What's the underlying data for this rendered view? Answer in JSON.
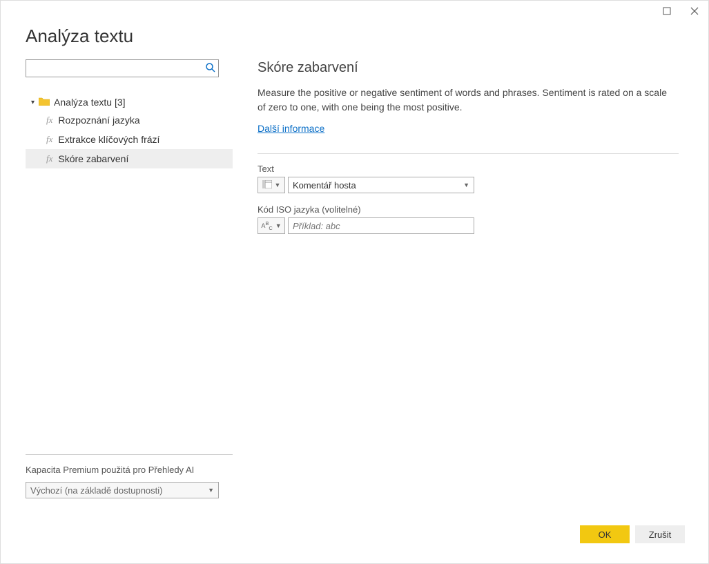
{
  "window": {
    "title": "Analýza textu"
  },
  "search": {
    "value": "",
    "placeholder": ""
  },
  "tree": {
    "root_label": "Analýza textu [3]",
    "items": [
      {
        "label": "Rozpoznání jazyka"
      },
      {
        "label": "Extrakce klíčových frází"
      },
      {
        "label": "Skóre zabarvení"
      }
    ]
  },
  "premium": {
    "label": "Kapacita Premium použitá pro Přehledy AI",
    "value": "Výchozí (na základě dostupnosti)"
  },
  "detail": {
    "title": "Skóre zabarvení",
    "description": "Measure the positive or negative sentiment of words and phrases. Sentiment is rated on a scale of zero to one, with one being the most positive.",
    "more_info_label": "Další informace",
    "fields": {
      "text_label": "Text",
      "text_value": "Komentář hosta",
      "iso_label": "Kód ISO jazyka (volitelné)",
      "iso_placeholder": "Příklad: abc",
      "type_icon_col": "column-icon",
      "type_icon_abc": "ABC"
    }
  },
  "footer": {
    "ok_label": "OK",
    "cancel_label": "Zrušit"
  }
}
